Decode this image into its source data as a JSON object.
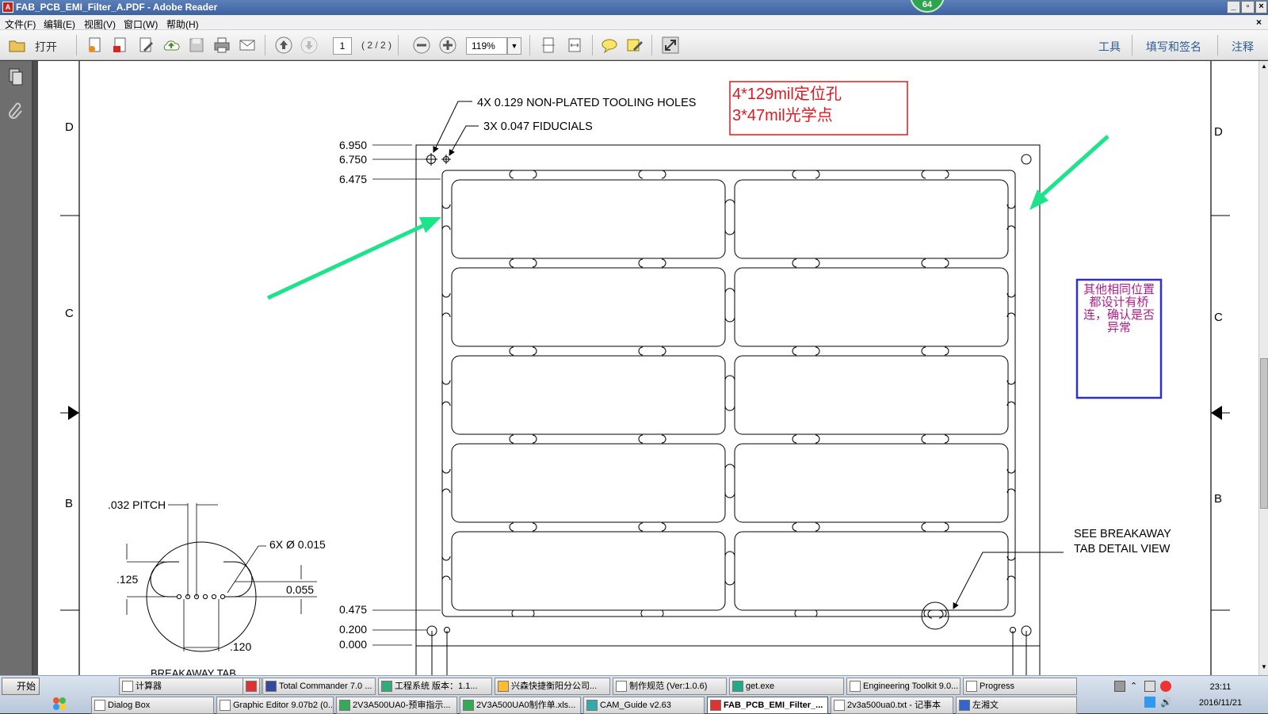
{
  "window": {
    "title": "FAB_PCB_EMI_Filter_A.PDF - Adobe Reader",
    "badge": "64"
  },
  "menu": [
    "文件(F)",
    "编辑(E)",
    "视图(V)",
    "窗口(W)",
    "帮助(H)"
  ],
  "toolbar": {
    "open_label": "打开",
    "page_number": "1",
    "page_count": "( 2 / 2 )",
    "zoom": "119%",
    "right_links": [
      "工具",
      "填写和签名",
      "注释"
    ]
  },
  "drawing": {
    "zone_letters_left": [
      "D",
      "C",
      "B"
    ],
    "zone_letters_right": [
      "D",
      "C",
      "B"
    ],
    "callout_tooling": "4X 0.129 NON-PLATED TOOLING HOLES",
    "callout_fiducials": "3X 0.047 FIDUCIALS",
    "y_dims": [
      "6.950",
      "6.750",
      "6.475",
      "0.475",
      "0.200",
      "0.000"
    ],
    "red_note_lines": [
      "4*129mil定位孔",
      "3*47mil光学点"
    ],
    "blue_note": "其他相同位置都设计有桥连，确认是否异常",
    "breakaway_note_lines": [
      "SEE BREAKAWAY",
      "TAB DETAIL VIEW"
    ],
    "detail": {
      "pitch": ".032 PITCH",
      "holes": "6X Ø 0.015",
      "height": ".125",
      "dim_055": "0.055",
      "dim_120": ".120",
      "title": "BREAKAWAY TAB"
    },
    "colors": {
      "arrow": "#1de38a",
      "red_note": "#e0181f",
      "blue_box": "#2d2fd0",
      "note_text": "#b01c8a"
    }
  },
  "taskbar": {
    "start": "开始",
    "row1": [
      "计算器",
      "",
      "Total Commander 7.0 ...",
      "工程系统  版本：1.1...",
      "兴森快捷衡阳分公司...",
      "制作规范 (Ver:1.0.6)",
      "get.exe",
      "Engineering Toolkit 9.0...",
      "Progress"
    ],
    "row2": [
      "Dialog Box",
      "Graphic Editor 9.07b2 (0...",
      "2V3A500UA0-预审指示...",
      "2V3A500UA0制作单.xls...",
      "CAM_Guide v2.63",
      "FAB_PCB_EMI_Filter_...",
      "2v3a500ua0.txt - 记事本",
      "左湘文"
    ],
    "time": "23:11",
    "date": "2016/11/21"
  }
}
